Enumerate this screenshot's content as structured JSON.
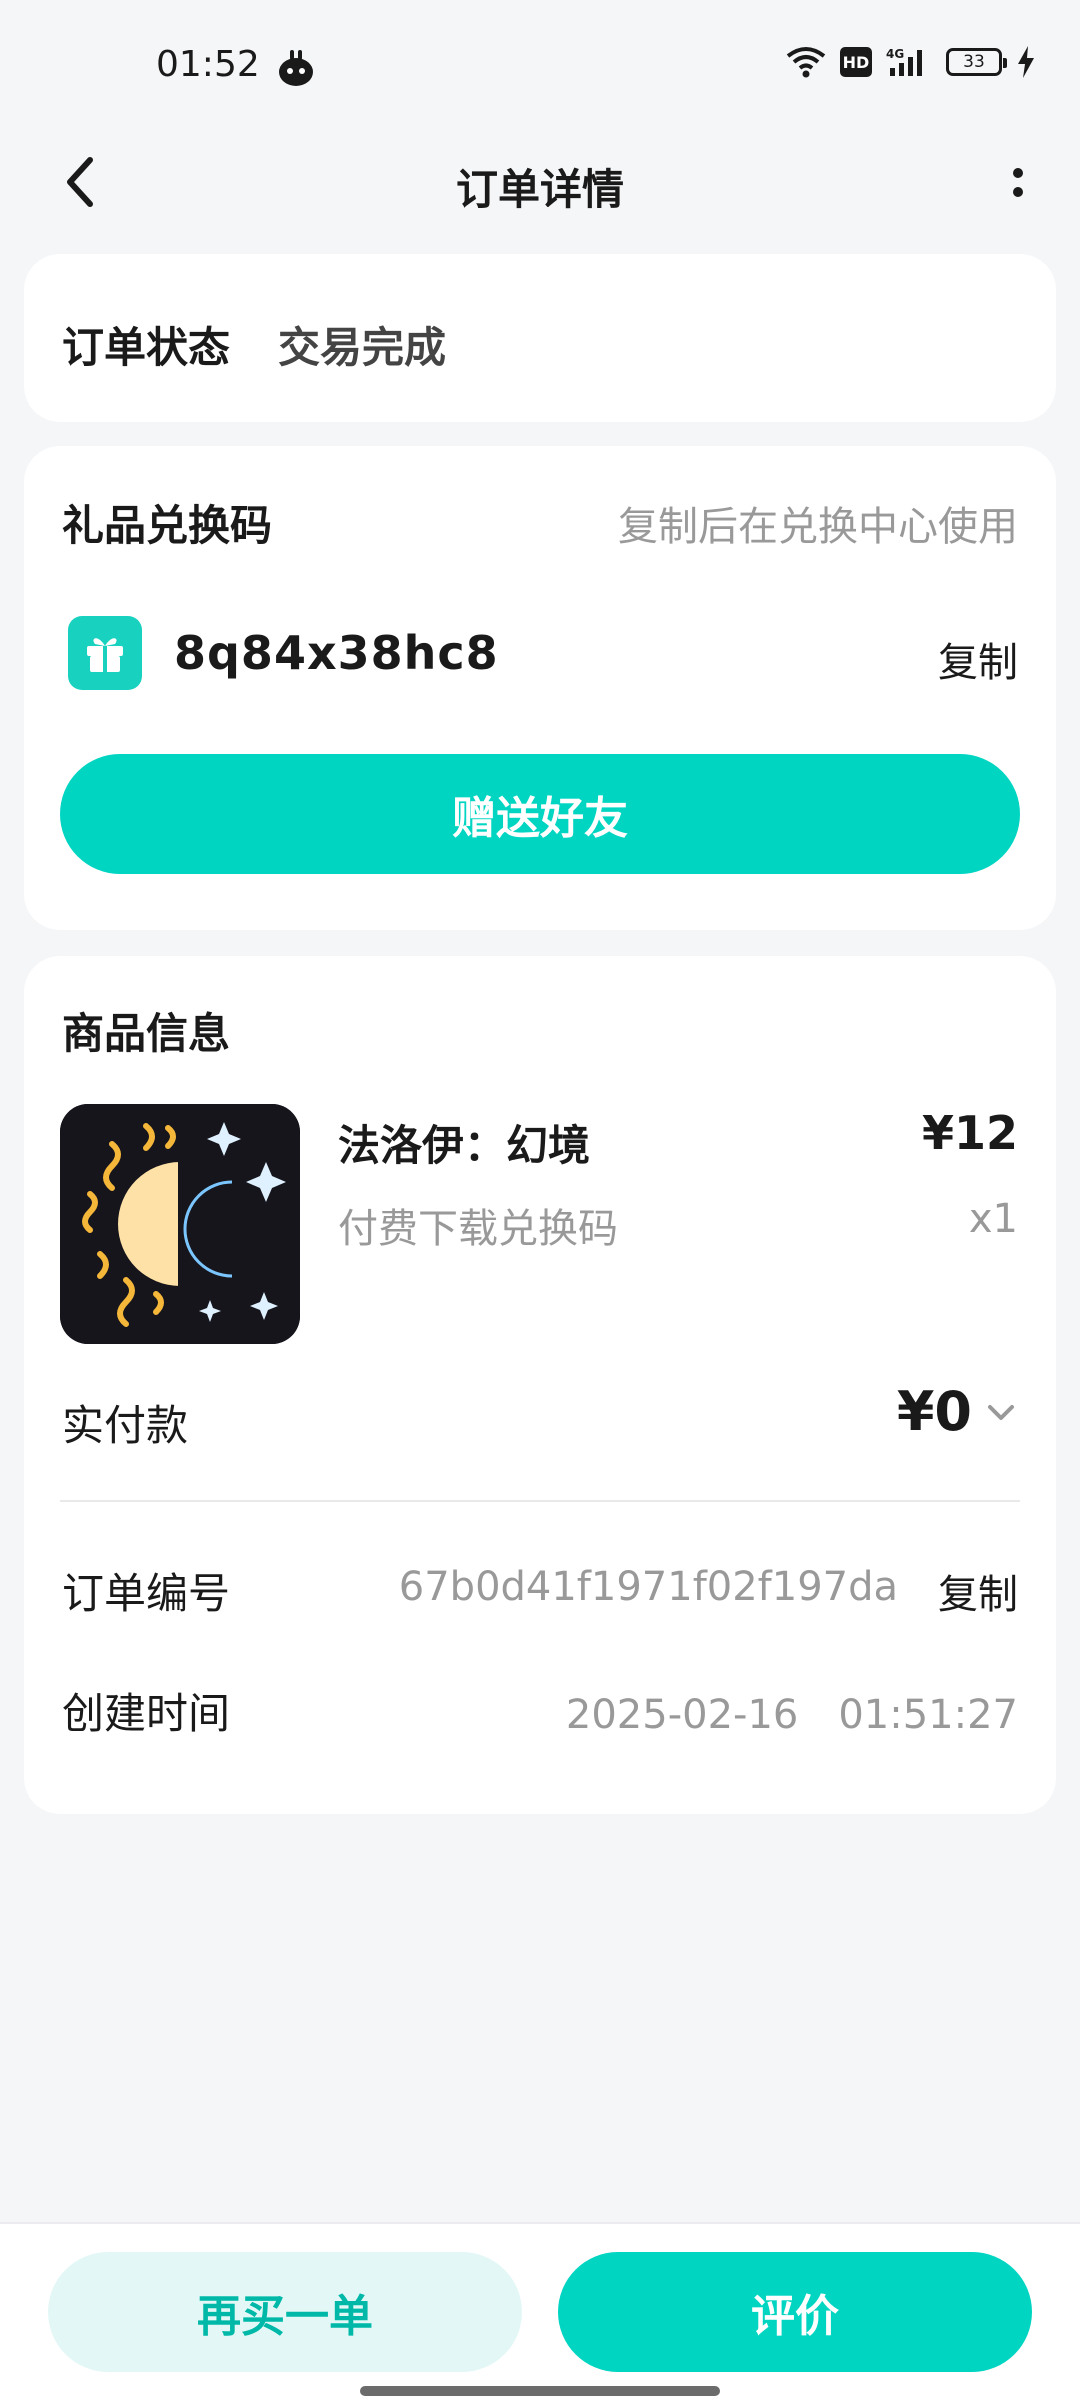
{
  "status_bar": {
    "time": "01:52",
    "network": "4G",
    "battery_level": "33"
  },
  "nav": {
    "title": "订单详情"
  },
  "order_status": {
    "label": "订单状态",
    "value": "交易完成"
  },
  "gift_code": {
    "title": "礼品兑换码",
    "hint": "复制后在兑换中心使用",
    "code": "8q84x38hc8",
    "copy_label": "复制",
    "gift_button_label": "赠送好友",
    "accent_color": "#00d5c2"
  },
  "product": {
    "section_title": "商品信息",
    "name": "法洛伊：幻境",
    "description": "付费下载兑换码",
    "price": "¥12",
    "quantity": "x1",
    "paid_label": "实付款",
    "paid_amount": "¥0",
    "order_no_label": "订单编号",
    "order_no": "67b0d41f1971f02f197da",
    "order_copy_label": "复制",
    "created_label": "创建时间",
    "created_time": "2025-02-16　01:51:27"
  },
  "bottom": {
    "rebuy_label": "再买一单",
    "review_label": "评价"
  }
}
